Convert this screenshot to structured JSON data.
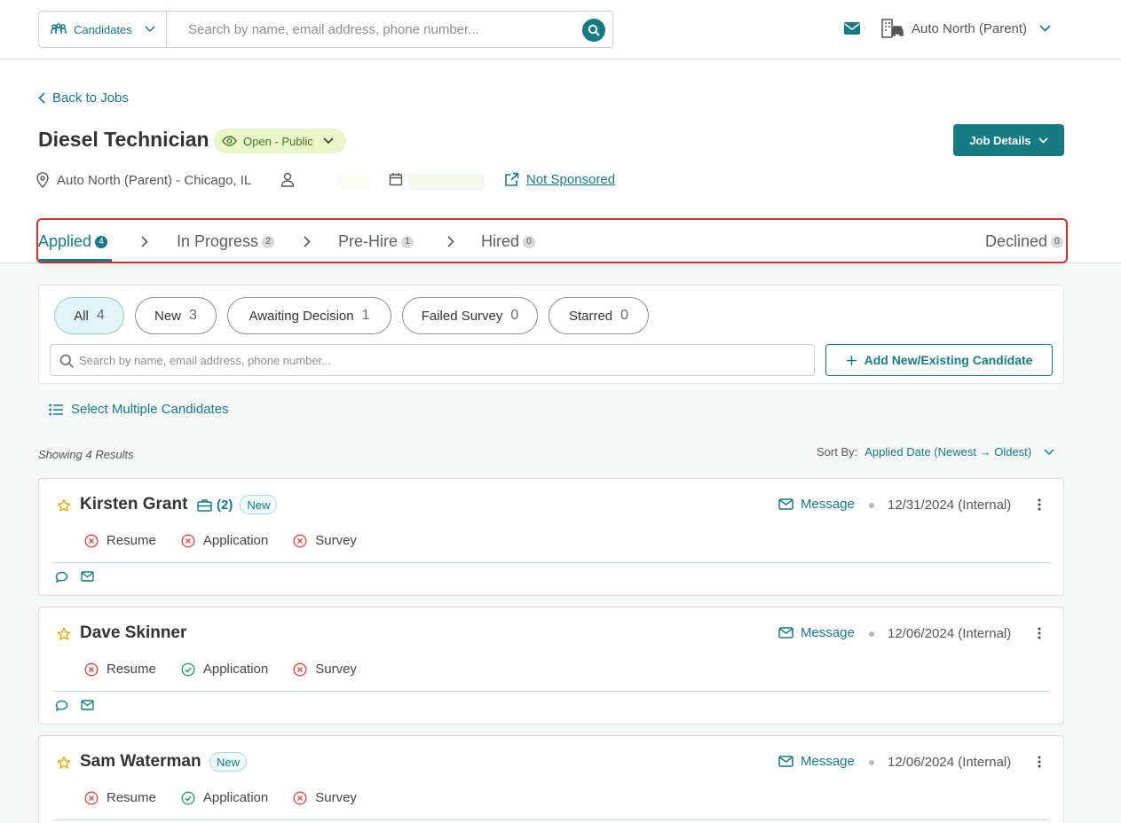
{
  "topbar": {
    "category_label": "Candidates",
    "search_placeholder": "Search by name, email address, phone number...",
    "org_name": "Auto North (Parent)"
  },
  "header": {
    "back_label": "Back to Jobs",
    "job_title": "Diesel Technician",
    "status_label": "Open - Public",
    "job_details_label": "Job Details",
    "location": "Auto North (Parent) - Chicago, IL",
    "sponsor_label": "Not Sponsored"
  },
  "stages": [
    {
      "label": "Applied",
      "count": "4"
    },
    {
      "label": "In Progress",
      "count": "2"
    },
    {
      "label": "Pre-Hire",
      "count": "1"
    },
    {
      "label": "Hired",
      "count": "0"
    },
    {
      "label": "Declined",
      "count": "0"
    }
  ],
  "filters": {
    "chips": [
      {
        "label": "All",
        "count": "4"
      },
      {
        "label": "New",
        "count": "3"
      },
      {
        "label": "Awaiting Decision",
        "count": "1"
      },
      {
        "label": "Failed Survey",
        "count": "0"
      },
      {
        "label": "Starred",
        "count": "0"
      }
    ],
    "search_placeholder": "Search by name, email address, phone number...",
    "add_label": "Add New/Existing Candidate"
  },
  "list": {
    "select_multiple_label": "Select Multiple Candidates",
    "showing_label": "Showing 4 Results",
    "sort_label": "Sort By:",
    "sort_value": "Applied Date (Newest → Oldest)"
  },
  "candidates": [
    {
      "name": "Kirsten Grant",
      "jobs_count": "(2)",
      "new_label": "New",
      "message_label": "Message",
      "date": "12/31/2024 (Internal)",
      "docs": [
        {
          "label": "Resume",
          "ok": false
        },
        {
          "label": "Application",
          "ok": false
        },
        {
          "label": "Survey",
          "ok": false
        }
      ]
    },
    {
      "name": "Dave Skinner",
      "message_label": "Message",
      "date": "12/06/2024 (Internal)",
      "docs": [
        {
          "label": "Resume",
          "ok": false
        },
        {
          "label": "Application",
          "ok": true
        },
        {
          "label": "Survey",
          "ok": false
        }
      ]
    },
    {
      "name": "Sam Waterman",
      "new_label": "New",
      "message_label": "Message",
      "date": "12/06/2024 (Internal)",
      "docs": [
        {
          "label": "Resume",
          "ok": false
        },
        {
          "label": "Application",
          "ok": true
        },
        {
          "label": "Survey",
          "ok": false
        }
      ]
    }
  ],
  "colors": {
    "accent": "#167a83",
    "status_green_bg": "#eaf6c9",
    "error": "#d84a4a",
    "success": "#2e9b5a",
    "star": "#e0a800",
    "highlight": "#d32f2f"
  }
}
